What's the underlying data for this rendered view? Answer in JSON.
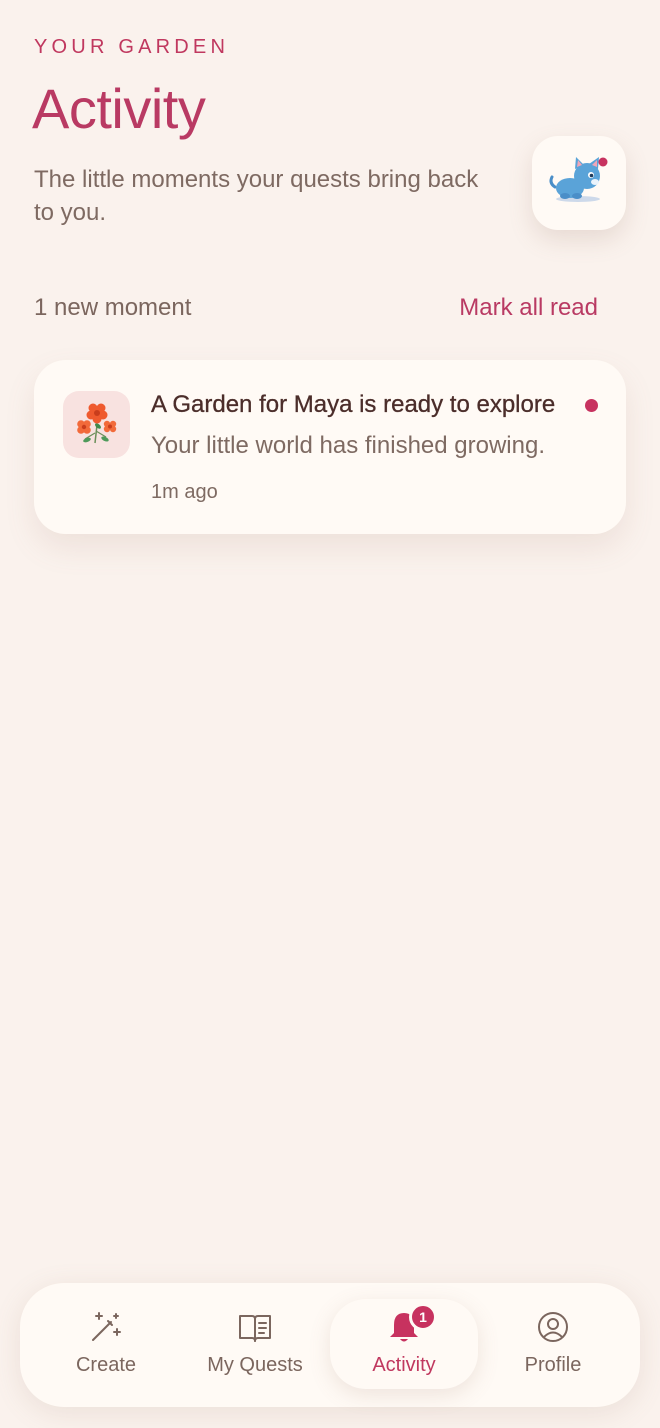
{
  "header": {
    "eyebrow": "YOUR GARDEN",
    "title": "Activity",
    "subtitle": "The little moments your quests bring back to you."
  },
  "mascot": {
    "icon": "cat-mascot-icon"
  },
  "summary": {
    "count_label": "1 new moment",
    "mark_all_label": "Mark all read"
  },
  "notifications": [
    {
      "icon": "flower-icon",
      "title": "A Garden for Maya is ready to explore",
      "body": "Your little world has finished growing.",
      "time": "1m ago",
      "unread": true
    }
  ],
  "nav": {
    "items": [
      {
        "label": "Create",
        "icon": "magic-wand-icon",
        "active": false
      },
      {
        "label": "My Quests",
        "icon": "book-icon",
        "active": false
      },
      {
        "label": "Activity",
        "icon": "bell-icon",
        "active": true,
        "badge": "1"
      },
      {
        "label": "Profile",
        "icon": "profile-icon",
        "active": false
      }
    ]
  },
  "colors": {
    "accent": "#b93a63",
    "background": "#faf2ed",
    "card": "#fffaf5",
    "text_dark": "#4b2d2a",
    "text_muted": "#7e6a62"
  }
}
